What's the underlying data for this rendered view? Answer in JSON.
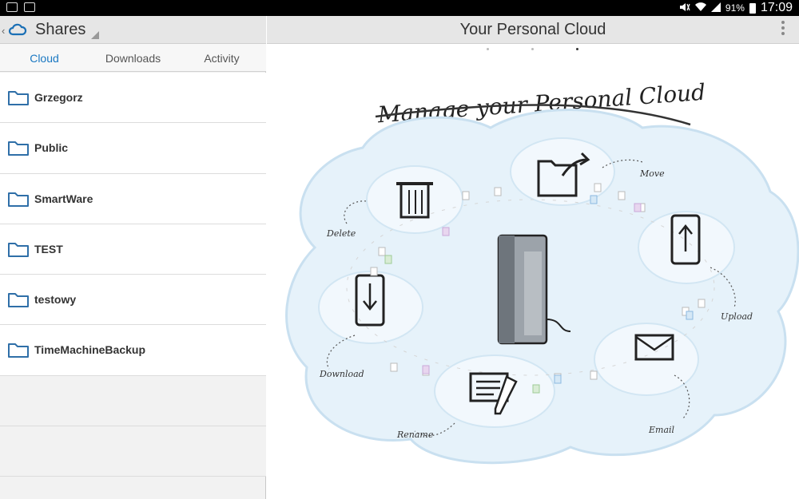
{
  "status_bar": {
    "battery_pct": "91%",
    "time": "17:09"
  },
  "left_panel": {
    "title": "Shares",
    "tabs": [
      {
        "label": "Cloud",
        "active": true
      },
      {
        "label": "Downloads",
        "active": false
      },
      {
        "label": "Activity",
        "active": false
      }
    ],
    "folders": [
      {
        "name": "Grzegorz"
      },
      {
        "name": "Public"
      },
      {
        "name": "SmartWare"
      },
      {
        "name": "TEST"
      },
      {
        "name": "testowy"
      },
      {
        "name": "TimeMachineBackup"
      }
    ]
  },
  "right_panel": {
    "title": "Your Personal Cloud",
    "pager": {
      "pages": 3,
      "current": 3
    },
    "illustration": {
      "heading": "Manage your Personal Cloud",
      "labels": {
        "move": "Move",
        "delete": "Delete",
        "upload": "Upload",
        "download": "Download",
        "email": "Email",
        "rename": "Rename"
      }
    }
  },
  "colors": {
    "accent": "#1a78c2",
    "folder_icon": "#2f6fa8",
    "cloud_fill": "#e6f2fa"
  }
}
